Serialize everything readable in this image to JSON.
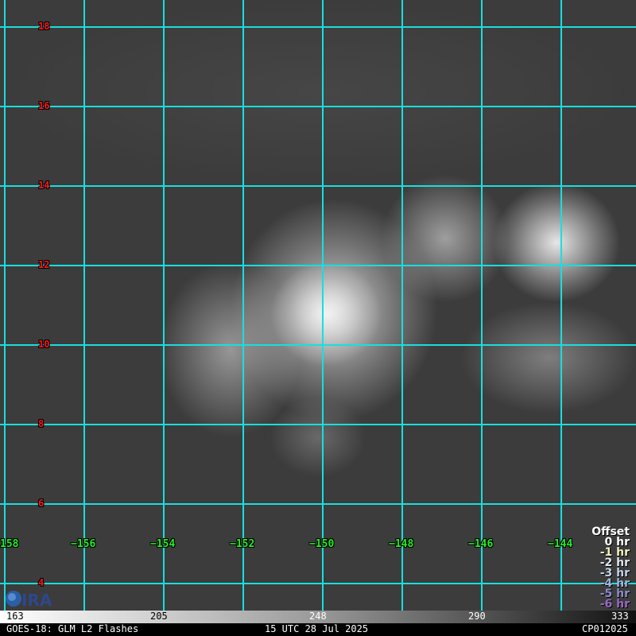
{
  "latitudes": [
    "18",
    "16",
    "14",
    "12",
    "10",
    "8",
    "6",
    "4"
  ],
  "longitudes": [
    "158",
    "−156",
    "−154",
    "−152",
    "−150",
    "−148",
    "−146",
    "−144"
  ],
  "offset": {
    "title": "Offset",
    "items": [
      {
        "label": "0 hr",
        "color": "#ffffff"
      },
      {
        "label": "-1 hr",
        "color": "#f4f0c0"
      },
      {
        "label": "-2 hr",
        "color": "#dfe6ef"
      },
      {
        "label": "-3 hr",
        "color": "#c4d4e6"
      },
      {
        "label": "-4 hr",
        "color": "#9fb4d8"
      },
      {
        "label": "-5 hr",
        "color": "#8c8cc8"
      },
      {
        "label": "-6 hr",
        "color": "#9a6ac2"
      }
    ]
  },
  "colorbar": {
    "ticks": [
      "163",
      "205",
      "248",
      "290",
      "333"
    ]
  },
  "footer": {
    "left": "GOES-18: GLM L2 Flashes",
    "center": "15 UTC 28 Jul 2025",
    "right": "CP012025"
  },
  "logo": {
    "text": "CIRA"
  }
}
